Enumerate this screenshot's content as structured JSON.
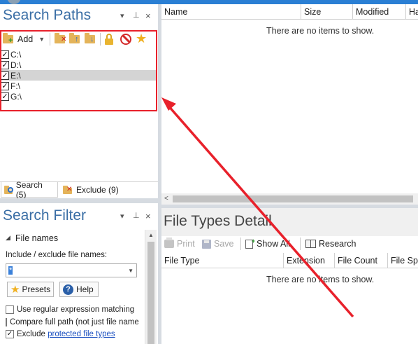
{
  "search_paths": {
    "title": "Search Paths",
    "add_label": "Add",
    "items": [
      {
        "label": "C:\\",
        "checked": true
      },
      {
        "label": "D:\\",
        "checked": true
      },
      {
        "label": "E:\\",
        "checked": true,
        "selected": true
      },
      {
        "label": "F:\\",
        "checked": true
      },
      {
        "label": "G:\\",
        "checked": true
      }
    ],
    "tabs": [
      {
        "label": "Search (5)"
      },
      {
        "label": "Exclude (9)"
      }
    ]
  },
  "search_filter": {
    "title": "Search Filter",
    "section_label": "File names",
    "include_label": "Include / exclude file names:",
    "include_value": "*",
    "presets_label": "Presets",
    "help_label": "Help",
    "options": [
      {
        "label": "Use regular expression matching",
        "checked": false
      },
      {
        "label": "Compare full path (not just file name",
        "checked": false
      },
      {
        "label": "Exclude ",
        "link": "protected file types",
        "checked": true
      }
    ]
  },
  "results": {
    "columns": [
      "Name",
      "Size",
      "Modified",
      "Ha"
    ],
    "empty_text": "There are no items to show."
  },
  "file_types": {
    "title": "File Types Detail",
    "toolbar": {
      "print": "Print",
      "save": "Save",
      "show_all": "Show All",
      "research": "Research"
    },
    "columns": [
      "File Type",
      "Extension",
      "File Count",
      "File Sp"
    ],
    "empty_text": "There are no items to show."
  },
  "colors": {
    "accent": "#3a6ea5",
    "highlight": "#e8212b",
    "selection": "#d4d4d4"
  }
}
